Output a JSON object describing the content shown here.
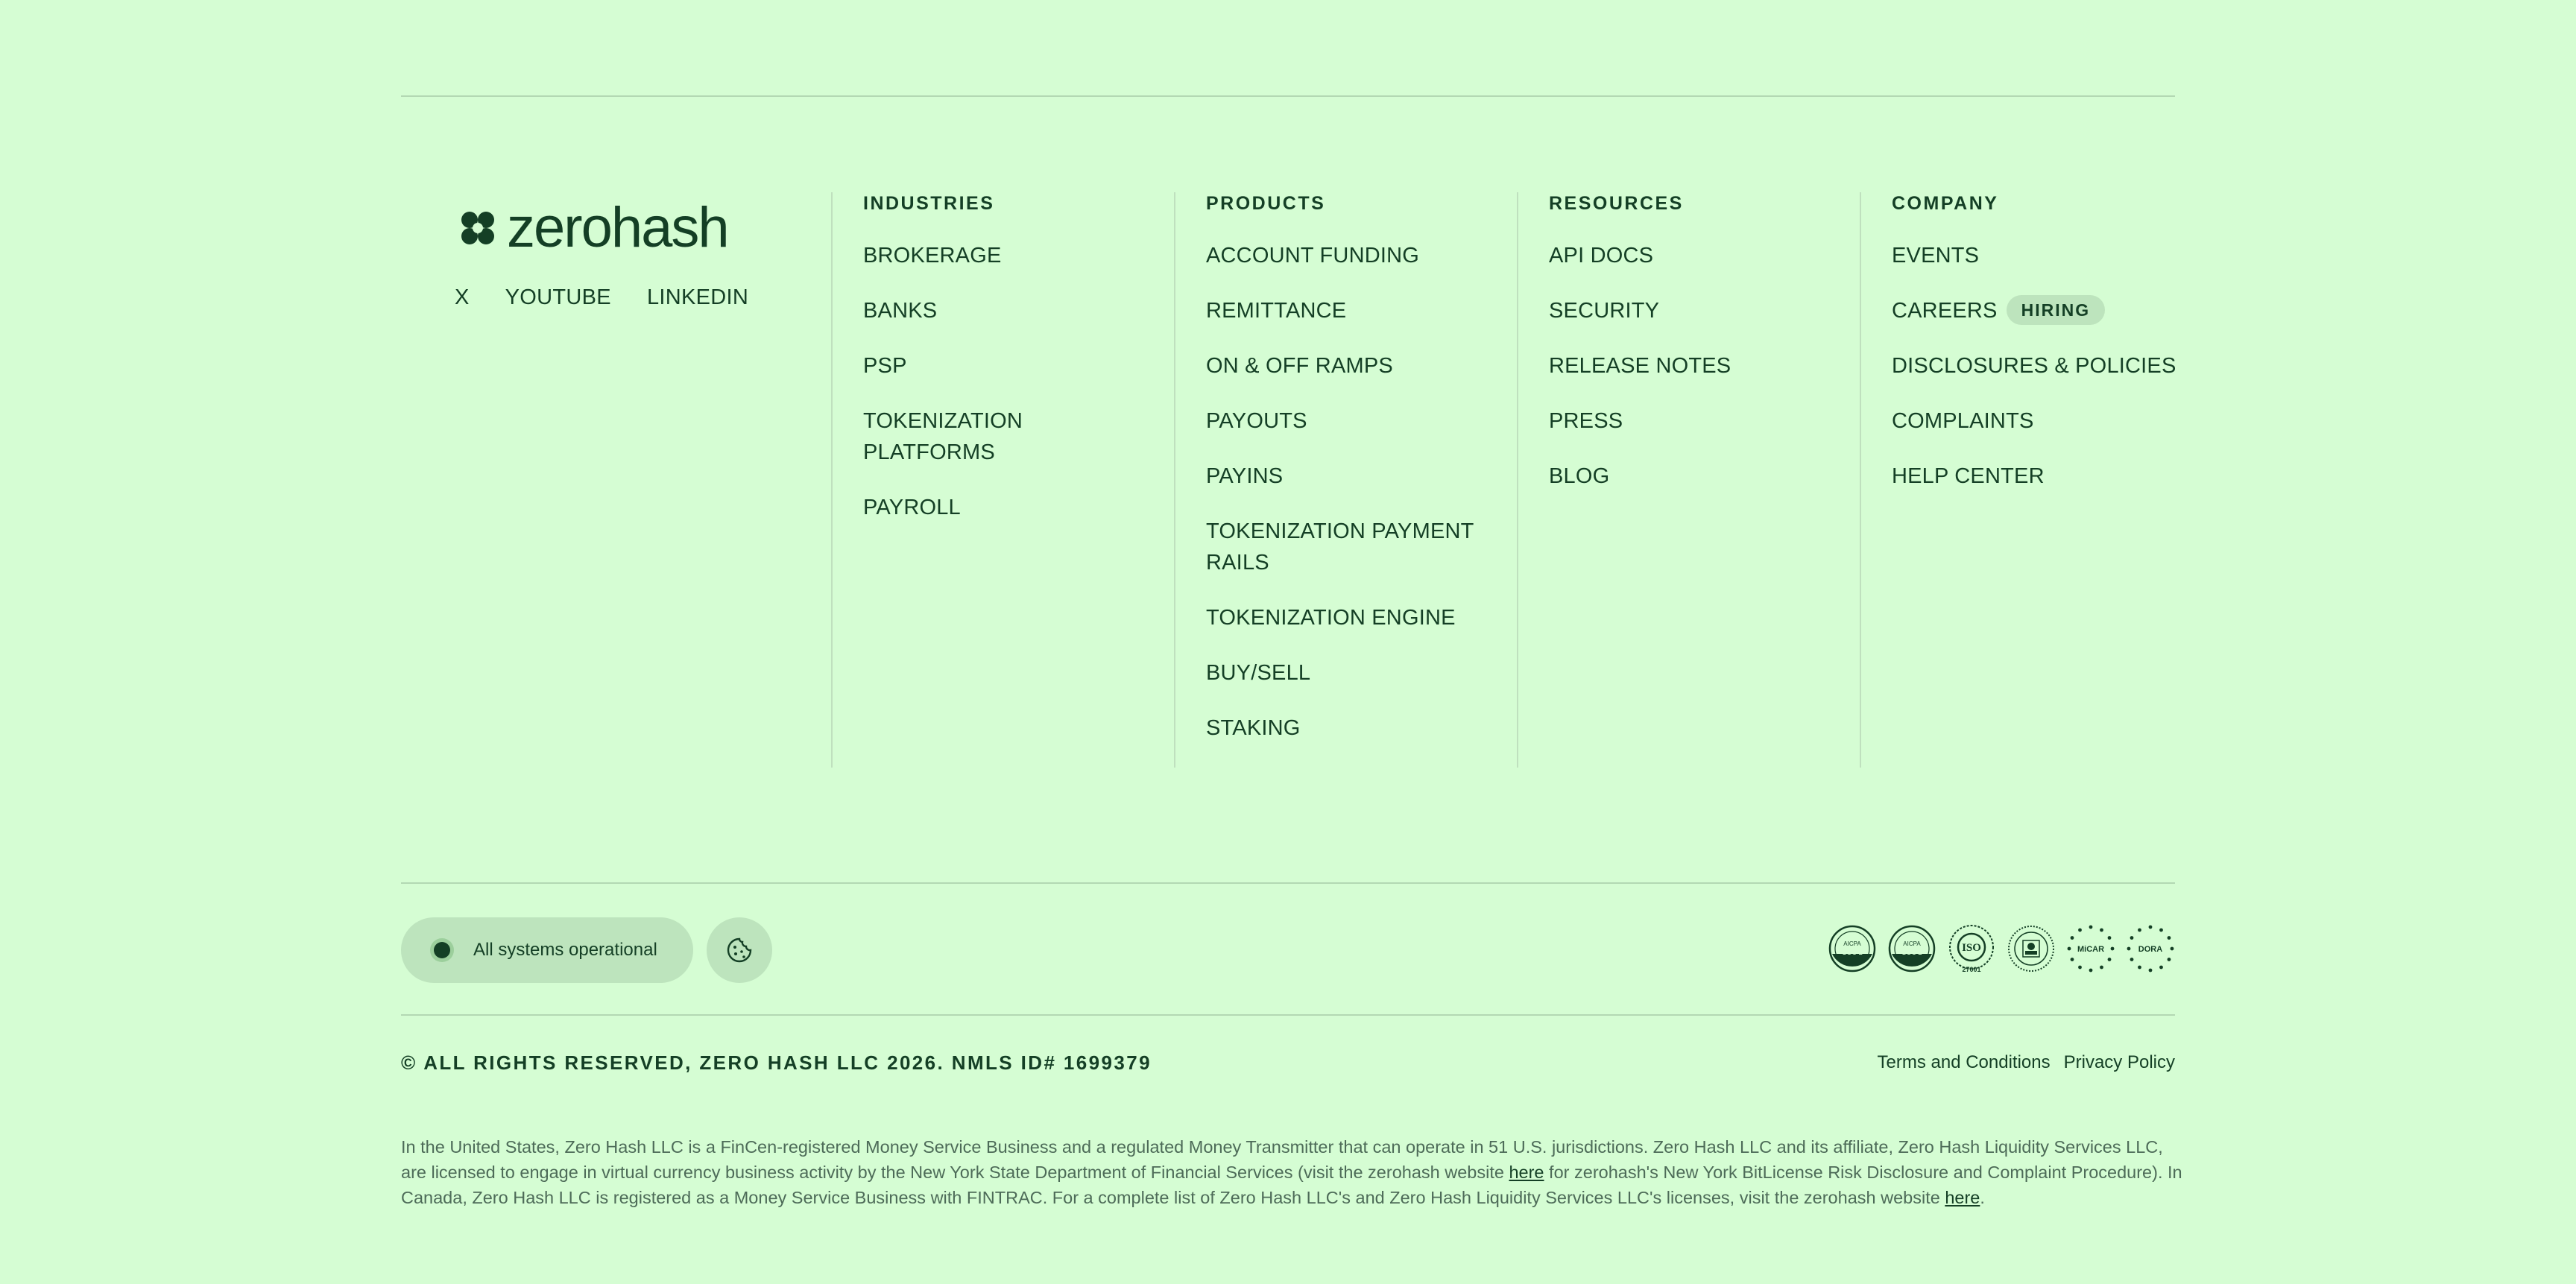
{
  "brand": {
    "name": "zerohash"
  },
  "social": [
    "X",
    "YOUTUBE",
    "LINKEDIN"
  ],
  "columns": [
    {
      "heading": "INDUSTRIES",
      "items": [
        "BROKERAGE",
        "BANKS",
        "PSP",
        "TOKENIZATION PLATFORMS",
        "PAYROLL"
      ]
    },
    {
      "heading": "PRODUCTS",
      "items": [
        "ACCOUNT FUNDING",
        "REMITTANCE",
        "ON & OFF RAMPS",
        "PAYOUTS",
        "PAYINS",
        "TOKENIZATION PAYMENT RAILS",
        "TOKENIZATION ENGINE",
        "BUY/SELL",
        "STAKING"
      ]
    },
    {
      "heading": "RESOURCES",
      "items": [
        "API DOCS",
        "SECURITY",
        "RELEASE NOTES",
        "PRESS",
        "BLOG"
      ]
    },
    {
      "heading": "COMPANY",
      "items": [
        "EVENTS",
        "CAREERS",
        "DISCLOSURES & POLICIES",
        "COMPLAINTS",
        "HELP CENTER"
      ],
      "badge": "HIRING"
    }
  ],
  "status": {
    "label": "All systems operational"
  },
  "certifications": [
    {
      "top": "AICPA",
      "bottom": "SOC 1",
      "icon": "soc1-badge-icon"
    },
    {
      "top": "AICPA",
      "bottom": "SOC 2",
      "icon": "soc2-badge-icon"
    },
    {
      "top": "ISO",
      "bottom": "27001",
      "icon": "iso-27001-badge-icon"
    },
    {
      "top": "",
      "bottom": "",
      "icon": "nys-seal-icon"
    },
    {
      "top": "MiCAR",
      "bottom": "",
      "icon": "micar-badge-icon"
    },
    {
      "top": "DORA",
      "bottom": "",
      "icon": "dora-badge-icon"
    }
  ],
  "legal": {
    "copyright": "© ALL RIGHTS RESERVED, ZERO HASH LLC 2026. NMLS ID# 1699379",
    "terms": "Terms and Conditions",
    "privacy": "Privacy Policy"
  },
  "disclaimer": {
    "part1": "In the United States, Zero Hash LLC is a FinCen-registered Money Service Business and a regulated Money Transmitter that can operate in 51 U.S. jurisdictions. Zero Hash LLC and its affiliate, Zero Hash Liquidity Services LLC, are licensed to engage in virtual currency business activity by the New York State Department of Financial Services (visit the zerohash website ",
    "link1": "here",
    "part2": " for zerohash's New York BitLicense Risk Disclosure and Complaint Procedure). In Canada, Zero Hash LLC is registered as a Money Service Business with FINTRAC. For a complete list of Zero Hash LLC's and Zero Hash Liquidity Services LLC's licenses, visit the zerohash website ",
    "link2": "here",
    "part3": "."
  },
  "colors": {
    "background": "#d5fdd3",
    "text": "#143f25",
    "pill": "#bde4bd"
  }
}
